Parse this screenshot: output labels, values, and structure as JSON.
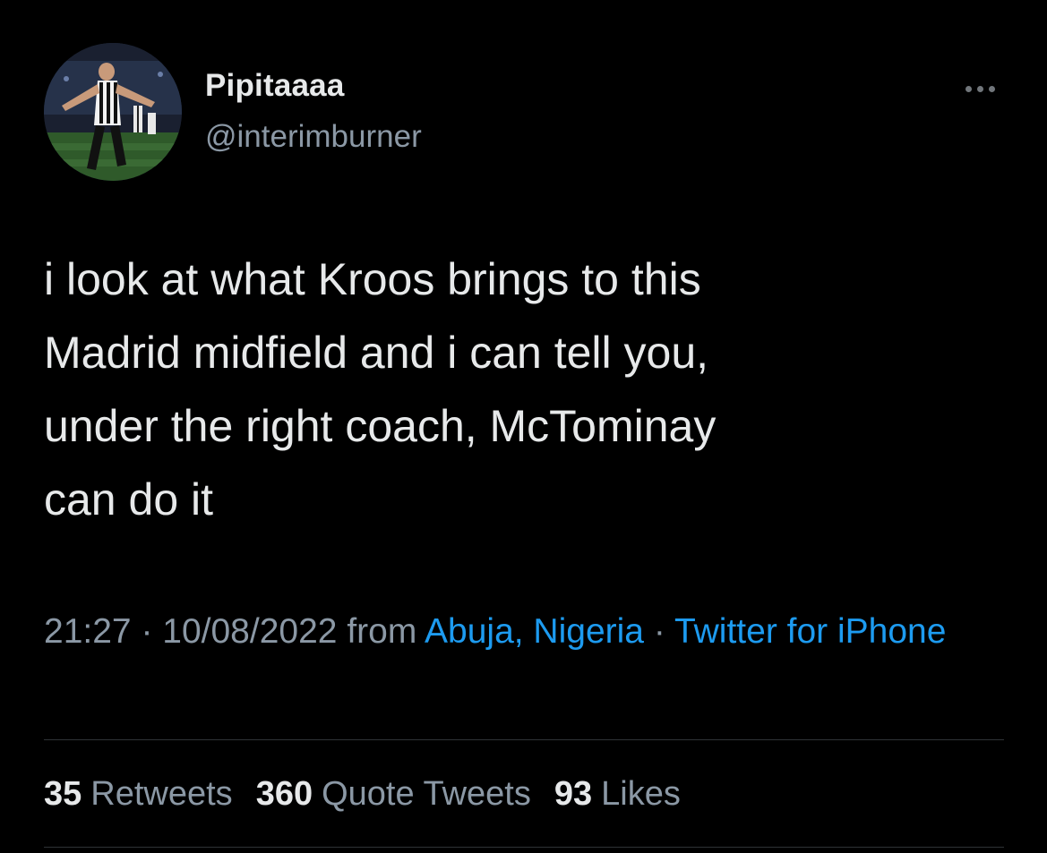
{
  "user": {
    "display_name": "Pipitaaaa",
    "handle": "@interimburner",
    "avatar_icon": "avatar-photo"
  },
  "more_icon": "more-dots-icon",
  "tweet": {
    "text": "i look at what Kroos brings to this\nMadrid midfield and i can tell you,\nunder the right coach, McTominay\ncan do it"
  },
  "meta": {
    "time": "21:27",
    "separator_1": " · ",
    "date": "10/08/2022",
    "from_label": " from ",
    "location": "Abuja, Nigeria",
    "separator_2": " · ",
    "source": "Twitter for iPhone"
  },
  "stats": {
    "retweets_count": "35",
    "retweets_label": "Retweets",
    "quotes_count": "360",
    "quotes_label": "Quote Tweets",
    "likes_count": "93",
    "likes_label": "Likes"
  },
  "colors": {
    "background": "#000000",
    "primary_text": "#e7e9ea",
    "secondary_text": "#8b98a5",
    "link": "#1d9bf0",
    "divider": "#2f3336"
  }
}
